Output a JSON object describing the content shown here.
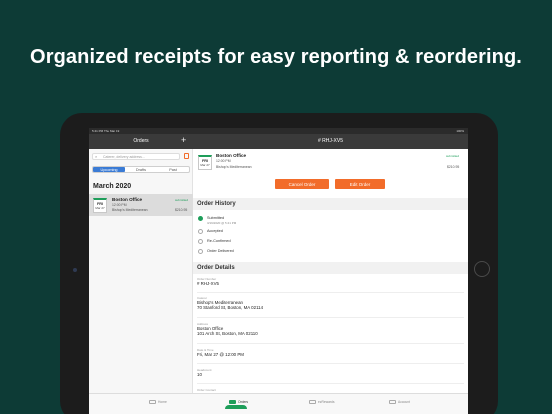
{
  "headline": "Organized receipts for easy reporting & reordering.",
  "status": {
    "time": "5:41 PM  Thu Mar 19",
    "battery": "100%"
  },
  "nav": {
    "left_title": "Orders",
    "add_icon": "+",
    "right_title": "# RHJ-XV5"
  },
  "search": {
    "placeholder": "Caterer, delivery address..."
  },
  "segments": {
    "items": [
      "Upcoming",
      "Drafts",
      "Past"
    ],
    "selected": "Upcoming"
  },
  "month": "March 2020",
  "order_card": {
    "dow": "FRI",
    "date": "Mar 27",
    "title": "Boston Office",
    "time": "12:00 PM",
    "caterer": "Bishop's Mediterranean",
    "status": "submitted",
    "amount": "$210.95"
  },
  "detail_card": {
    "dow": "FRI",
    "date": "Mar 27",
    "title": "Boston Office",
    "time": "12:00 PM",
    "caterer": "Bishop's Mediterranean",
    "status": "submitted",
    "amount": "$210.95"
  },
  "actions": {
    "cancel": "Cancel Order",
    "edit": "Edit Order"
  },
  "history": {
    "title": "Order History",
    "steps": [
      {
        "label": "Submitted",
        "sub": "3/19/2020 @ 5:41 PM",
        "done": true
      },
      {
        "label": "Accepted",
        "sub": "",
        "done": false
      },
      {
        "label": "Re-Confirmed",
        "sub": "",
        "done": false
      },
      {
        "label": "Order Delivered",
        "sub": "",
        "done": false
      }
    ]
  },
  "details": {
    "title": "Order Details",
    "fields": [
      {
        "label": "Order Number",
        "value": "# RHJ-XV5"
      },
      {
        "label": "Caterer",
        "value": "Bishop's Mediterranean",
        "value2": "70 Stanford St, Boston, MA 02114"
      },
      {
        "label": "Address",
        "value": "Boston Office",
        "value2": "101 Arch St, Boston, MA 02110"
      },
      {
        "label": "Date & Time",
        "value": "Fri, Mar 27 @ 12:00 PM"
      },
      {
        "label": "Headcount",
        "value": "10"
      },
      {
        "label": "Order Contact",
        "value": ""
      }
    ]
  },
  "tabbar": {
    "items": [
      {
        "label": "Home",
        "icon": "home-icon"
      },
      {
        "label": "Orders",
        "icon": "orders-icon"
      },
      {
        "label": "ezRewards",
        "icon": "rewards-icon"
      },
      {
        "label": "Account",
        "icon": "account-icon"
      }
    ],
    "active": "Orders"
  },
  "colors": {
    "background": "#0d3b36",
    "accent": "#f26c2a",
    "success": "#1e9e5a",
    "segment": "#3a7bd5"
  }
}
